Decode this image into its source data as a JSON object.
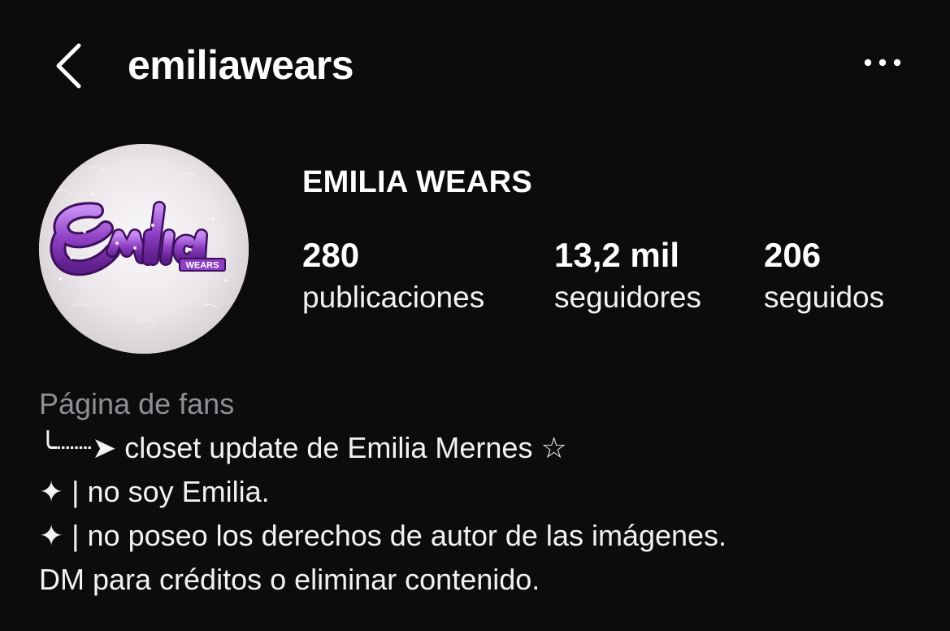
{
  "header": {
    "username": "emiliawears",
    "back_icon": "chevron-left-icon",
    "more_icon": "ellipsis-icon"
  },
  "profile": {
    "display_name": "EMILIA WEARS",
    "avatar": {
      "logo_text": "Emilia",
      "logo_subtext": "WEARS",
      "logo_color": "#8e3fc4"
    }
  },
  "stats": {
    "posts": {
      "value": "280",
      "label": "publicaciones"
    },
    "followers": {
      "value": "13,2 mil",
      "label": "seguidores"
    },
    "following": {
      "value": "206",
      "label": "seguidos"
    }
  },
  "bio": {
    "category": "Página de fans",
    "lines": [
      " ╰┈┈➤ closet update de Emilia Mernes ☆",
      "✦ | no soy Emilia.",
      "✦ | no poseo los derechos de autor de las imágenes.",
      "DM para créditos o eliminar contenido."
    ]
  },
  "colors": {
    "background": "#0c0c0e",
    "text": "#f5f5f5",
    "muted": "#8e8e93"
  }
}
